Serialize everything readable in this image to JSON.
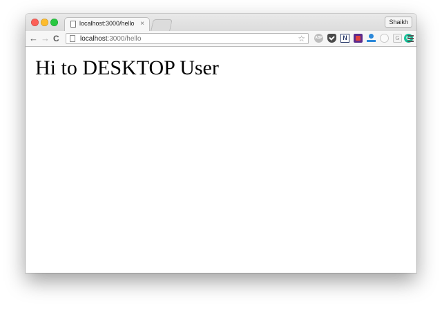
{
  "tab": {
    "title": "localhost:3000/hello",
    "close_glyph": "×",
    "icon": "page-icon"
  },
  "profile": {
    "name": "Shaikh"
  },
  "toolbar": {
    "back_glyph": "←",
    "forward_glyph": "→",
    "reload_glyph": "C",
    "bookmark_glyph": "☆"
  },
  "address_bar": {
    "host": "localhost",
    "path": ":3000/hello"
  },
  "extensions": [
    {
      "name": "adblock-plus-icon",
      "label": "ABP"
    },
    {
      "name": "pocket-icon"
    },
    {
      "name": "n-icon",
      "label": "N"
    },
    {
      "name": "clipper-icon"
    },
    {
      "name": "person-icon"
    },
    {
      "name": "ring-icon"
    },
    {
      "name": "g-icon",
      "label": "G"
    },
    {
      "name": "grammarly-icon",
      "label": "G"
    }
  ],
  "page": {
    "heading": "Hi to DESKTOP User"
  },
  "colors": {
    "close": "#fc5f57",
    "minimize": "#fdbc2e",
    "maximize": "#28c841",
    "grammarly": "#15c39a"
  }
}
